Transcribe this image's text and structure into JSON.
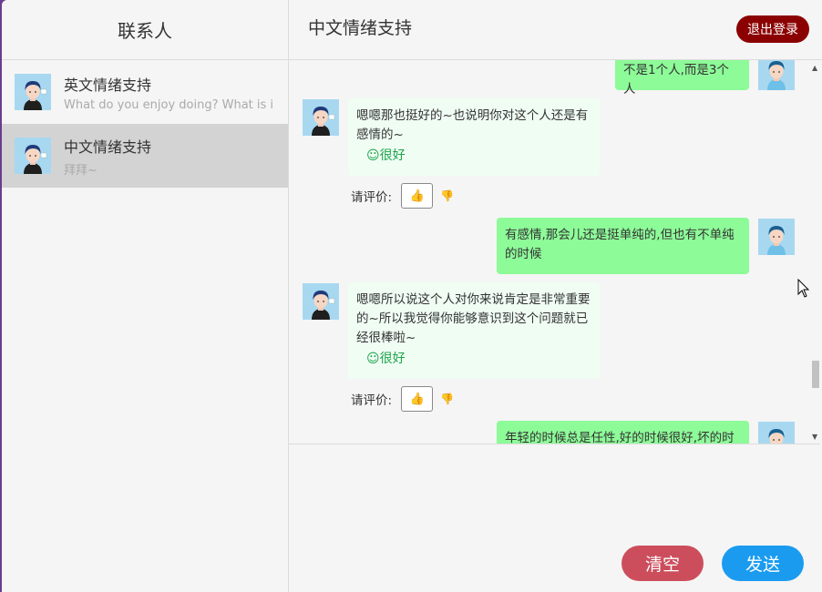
{
  "sidebar": {
    "title": "联系人",
    "contacts": [
      {
        "name": "英文情绪支持",
        "preview": "What do you enjoy doing? What is it"
      },
      {
        "name": "中文情绪支持",
        "preview": "拜拜~"
      }
    ]
  },
  "header": {
    "title": "中文情绪支持",
    "logout_label": "退出登录"
  },
  "messages": {
    "m0": {
      "text": "不是1个人,而是3个人"
    },
    "m1": {
      "text": "嗯嗯那也挺好的~也说明你对这个人还是有感情的~",
      "rating_text": "☺很好"
    },
    "m2": {
      "text": "有感情,那会儿还是挺单纯的,但也有不单纯的时候"
    },
    "m3": {
      "text": "嗯嗯所以说这个人对你来说肯定是非常重要的~所以我觉得你能够意识到这个问题就已经很棒啦~",
      "rating_text": "☺很好"
    },
    "m4": {
      "text": "年轻的时候总是任性,好的时候很好,坏的时候"
    },
    "rate_prompt": "请评价:",
    "thumb_up": "👍",
    "thumb_down": "👎"
  },
  "actions": {
    "clear_label": "清空",
    "send_label": "发送"
  },
  "colors": {
    "logout": "#8b0000",
    "user_bubble": "#8dfb98",
    "bot_bubble": "#f0fdf3",
    "clear": "#cc4e5c",
    "send": "#1a9bf0",
    "active_contact": "#d3d3d3"
  }
}
